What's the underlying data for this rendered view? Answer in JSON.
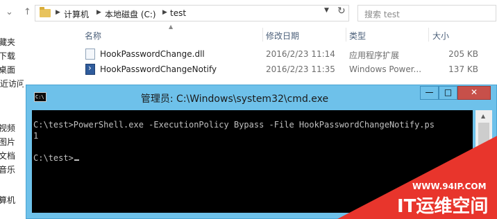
{
  "explorer": {
    "address": {
      "crumbs": [
        "计算机",
        "本地磁盘 (C:)",
        "test"
      ]
    },
    "search": {
      "placeholder": "搜索 test"
    },
    "sidebar": {
      "items": [
        "藏夹",
        "下载",
        "桌面",
        "最近访问的位置",
        "视频",
        "图片",
        "文档",
        "音乐",
        "算机"
      ]
    },
    "columns": [
      "名称",
      "修改日期",
      "类型",
      "大小"
    ],
    "files": [
      {
        "name": "HookPasswordChange.dll",
        "date": "2016/2/23 11:14",
        "type": "应用程序扩展",
        "size": "205 KB",
        "icon": "dll-file-icon"
      },
      {
        "name": "HookPasswordChangeNotify",
        "date": "2016/2/23 11:35",
        "type": "Windows Power...",
        "size": "137 KB",
        "icon": "powershell-file-icon"
      }
    ]
  },
  "cmd": {
    "icon_text": "C:\\",
    "title": "管理员: C:\\Windows\\system32\\cmd.exe",
    "buttons": {
      "minimize": "—",
      "maximize": "□",
      "close": "✕"
    },
    "lines": [
      "C:\\test>PowerShell.exe -ExecutionPolicy Bypass -File HookPasswordChangeNotify.ps",
      "1",
      "",
      "C:\\test>"
    ]
  },
  "watermark": {
    "url": "WWW.94IP.COM",
    "brand": "IT运维空间"
  },
  "colors": {
    "cmd_frame": "#6ec1ea",
    "close_button": "#c7504a",
    "column_header_text": "#4c607a",
    "watermark_red": "#e8352c"
  }
}
